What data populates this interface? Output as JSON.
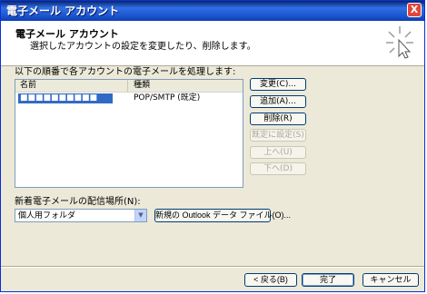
{
  "window": {
    "title": "電子メール アカウント",
    "close_symbol": "X"
  },
  "header": {
    "title": "電子メール アカウント",
    "description": "選択したアカウントの設定を変更したり、削除します。",
    "icon": "wizard-sparkle-icon"
  },
  "accounts": {
    "label": "以下の順番で各アカウントの電子メールを処理します:",
    "columns": [
      "名前",
      "種類"
    ],
    "rows": [
      {
        "name": "■■■■■■■■■■",
        "type": "POP/SMTP (既定)",
        "selected": true
      }
    ]
  },
  "side_buttons": {
    "change": "変更(C)...",
    "add": "追加(A)...",
    "remove": "削除(R)",
    "set_default": "既定に設定(S)",
    "up": "上へ(U)",
    "down": "下へ(D)"
  },
  "delivery": {
    "label": "新着電子メールの配信場所(N):",
    "selected": "個人用フォルダ",
    "new_file_button": "新規の Outlook データ ファイル(O)..."
  },
  "nav": {
    "back": "< 戻る(B)",
    "finish": "完了",
    "cancel": "キャンセル"
  },
  "colors": {
    "titlebar": "#0a246a",
    "selection": "#316ac5",
    "dialog_bg": "#ece9d8"
  }
}
